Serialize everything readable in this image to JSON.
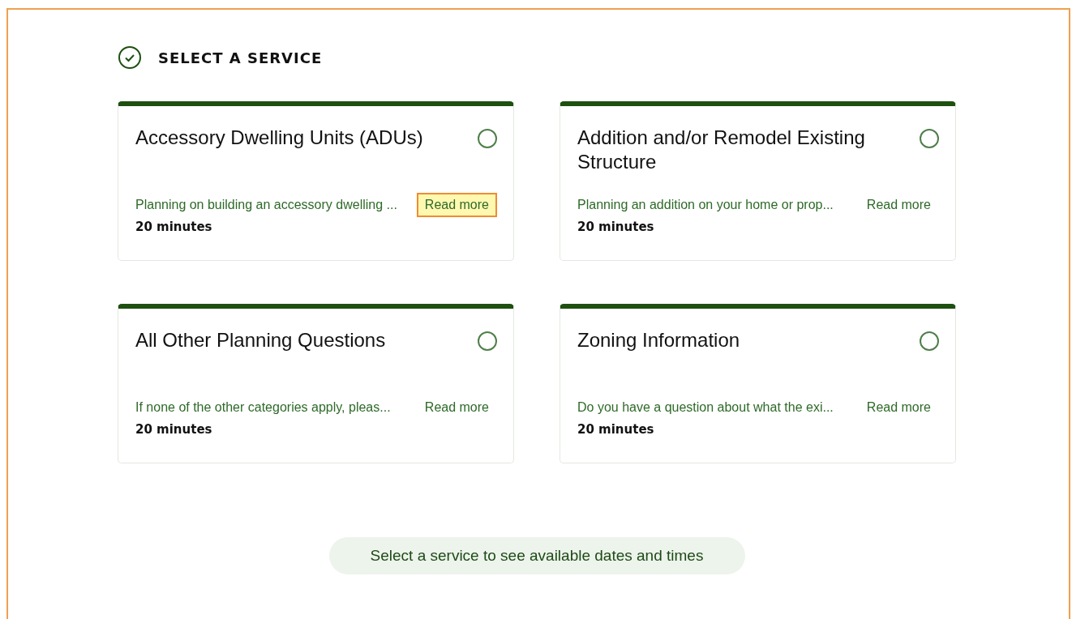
{
  "section": {
    "title": "SELECT A SERVICE",
    "completed": true
  },
  "services": [
    {
      "title": "Accessory Dwelling Units (ADUs)",
      "description": "Planning on building an accessory dwelling ...",
      "link": "Read more",
      "link_highlighted": true,
      "duration": "20 minutes",
      "selected": false
    },
    {
      "title": "Addition and/or Remodel Existing Structure",
      "description": "Planning an addition on your home or prop...",
      "link": "Read more",
      "link_highlighted": false,
      "duration": "20 minutes",
      "selected": false
    },
    {
      "title": "All Other Planning Questions",
      "description": "If none of the other categories apply, pleas...",
      "link": "Read more",
      "link_highlighted": false,
      "duration": "20 minutes",
      "selected": false
    },
    {
      "title": "Zoning Information",
      "description": "Do you have a question about what the exi...",
      "link": "Read more",
      "link_highlighted": false,
      "duration": "20 minutes",
      "selected": false
    }
  ],
  "continue_button": {
    "label": "Select a service to see available dates and times",
    "disabled": true
  }
}
